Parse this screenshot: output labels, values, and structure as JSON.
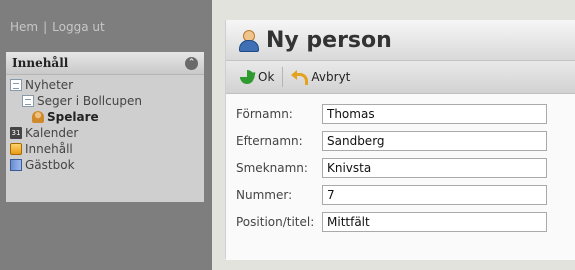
{
  "nav": {
    "home": "Hem",
    "separator": "|",
    "logout": "Logga ut"
  },
  "sidebar": {
    "title": "Innehåll",
    "items": [
      {
        "label": "Nyheter",
        "icon": "page-icon"
      },
      {
        "label": "Seger i Bollcupen",
        "icon": "page-icon"
      },
      {
        "label": "Spelare",
        "icon": "people-icon"
      },
      {
        "label": "Kalender",
        "icon": "calendar-icon",
        "icon_text": "31"
      },
      {
        "label": "Innehåll",
        "icon": "box-icon"
      },
      {
        "label": "Gästbok",
        "icon": "guestbook-icon"
      }
    ]
  },
  "form": {
    "title": "Ny person",
    "toolbar": {
      "ok": "Ok",
      "cancel": "Avbryt"
    },
    "fields": [
      {
        "label": "Förnamn:",
        "value": "Thomas"
      },
      {
        "label": "Efternamn:",
        "value": "Sandberg"
      },
      {
        "label": "Smeknamn:",
        "value": "Knivsta"
      },
      {
        "label": "Nummer:",
        "value": "7"
      },
      {
        "label": "Position/titel:",
        "value": "Mittfält"
      }
    ]
  }
}
